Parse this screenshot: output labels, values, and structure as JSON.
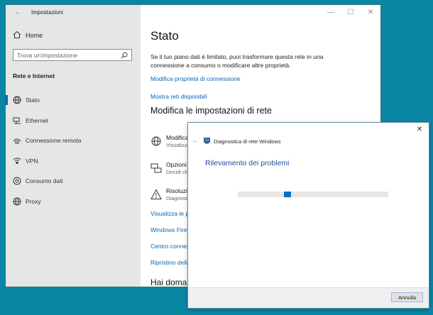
{
  "settings": {
    "window_title": "Impostazioni",
    "controls": {
      "minimize": "—",
      "maximize": "☐",
      "close": "✕"
    },
    "home_label": "Home",
    "search": {
      "placeholder": "Trova un'impostazione"
    },
    "section_title": "Rete e Internet",
    "nav_items": [
      {
        "label": "Stato",
        "icon": "globe-icon",
        "active": true
      },
      {
        "label": "Ethernet",
        "icon": "ethernet-icon"
      },
      {
        "label": "Connessione remota",
        "icon": "dialup-icon"
      },
      {
        "label": "VPN",
        "icon": "vpn-icon"
      },
      {
        "label": "Consumo dati",
        "icon": "data-usage-icon"
      },
      {
        "label": "Proxy",
        "icon": "proxy-icon"
      }
    ],
    "main": {
      "title": "Stato",
      "description": "Se il tuo piano dati è limitato, puoi trasformare questa rete in una connessione a consumo o modificare altre proprietà.",
      "link_properties": "Modifica proprietà di connessione",
      "link_networks": "Mostra reti disponibili",
      "subheading": "Modifica le impostazioni di rete",
      "options": [
        {
          "title": "Modifica",
          "subtitle": "Visualizza",
          "icon": "adapter-options-icon"
        },
        {
          "title": "Opzioni",
          "subtitle": "Decidi ch",
          "icon": "sharing-options-icon"
        },
        {
          "title": "Risoluzi",
          "subtitle": "Diagnost",
          "icon": "warning-icon"
        }
      ],
      "links": [
        "Visualizza le p",
        "Windows Firev",
        "Centro conness",
        "Ripristino della"
      ],
      "help_heading": "Hai domar"
    }
  },
  "dialog": {
    "close": "✕",
    "back": "←",
    "app_title": "Diagnostica di rete Windows",
    "heading": "Rilevamento dei problemi",
    "progress_position": 0.32,
    "cancel_label": "Annulla"
  },
  "colors": {
    "desktop": "#0a86a5",
    "accent": "#0067c0",
    "progress": "#0a6fc2"
  }
}
